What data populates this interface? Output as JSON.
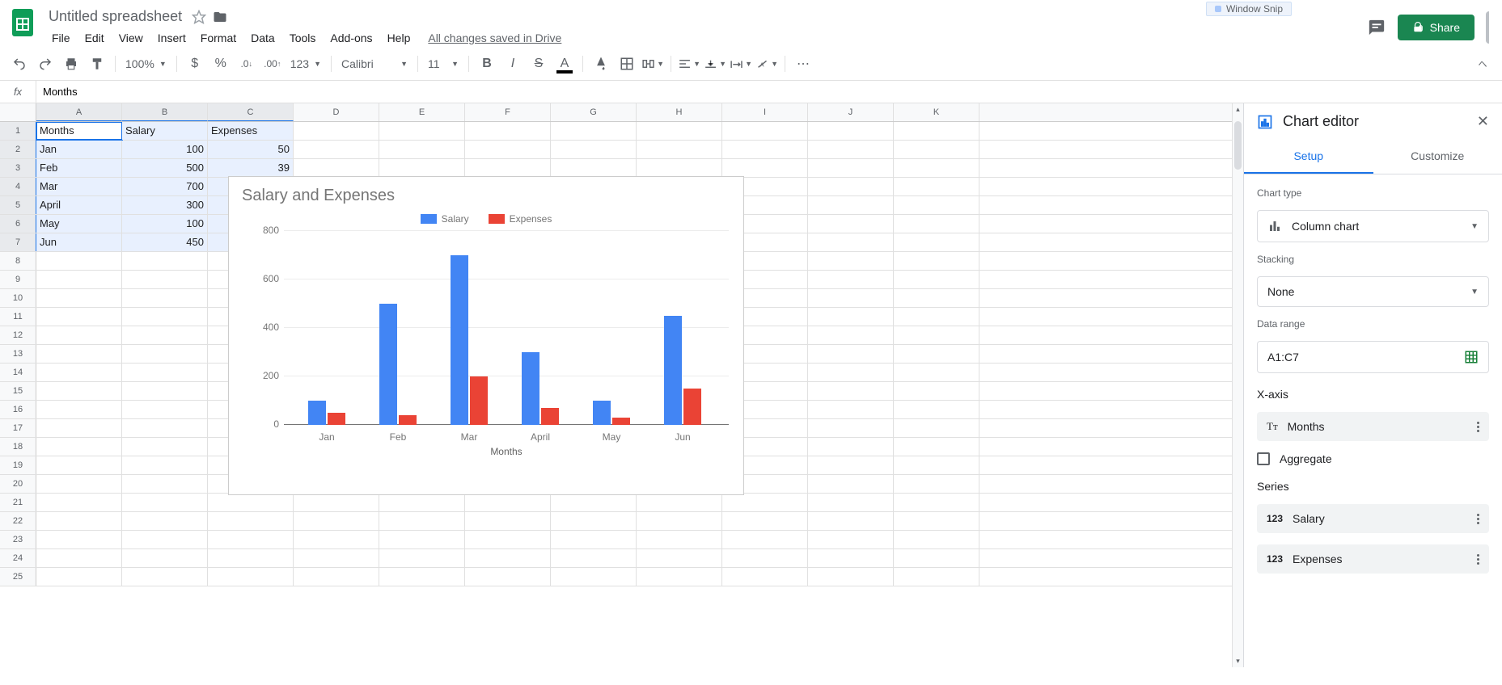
{
  "doc": {
    "title": "Untitled spreadsheet",
    "saved": "All changes saved in Drive"
  },
  "menus": [
    "File",
    "Edit",
    "View",
    "Insert",
    "Format",
    "Data",
    "Tools",
    "Add-ons",
    "Help"
  ],
  "share": "Share",
  "snip": "Window Snip",
  "toolbar": {
    "zoom": "100%",
    "fmt123": "123",
    "font": "Calibri",
    "size": "11"
  },
  "formula": {
    "value": "Months"
  },
  "columns": [
    "A",
    "B",
    "C",
    "D",
    "E",
    "F",
    "G",
    "H",
    "I",
    "J",
    "K"
  ],
  "sheet": {
    "headers": [
      "Months",
      "Salary",
      "Expenses"
    ],
    "rows": [
      [
        "Jan",
        "100",
        "50"
      ],
      [
        "Feb",
        "500",
        "39"
      ],
      [
        "Mar",
        "700",
        ""
      ],
      [
        "April",
        "300",
        ""
      ],
      [
        "May",
        "100",
        ""
      ],
      [
        "Jun",
        "450",
        ""
      ]
    ]
  },
  "chart_data": {
    "type": "bar",
    "title": "Salary and Expenses",
    "xlabel": "Months",
    "ylabel": "",
    "ylim": [
      0,
      800
    ],
    "yticks": [
      0,
      200,
      400,
      600,
      800
    ],
    "categories": [
      "Jan",
      "Feb",
      "Mar",
      "April",
      "May",
      "Jun"
    ],
    "series": [
      {
        "name": "Salary",
        "color": "#4285f4",
        "values": [
          100,
          500,
          700,
          300,
          100,
          450
        ]
      },
      {
        "name": "Expenses",
        "color": "#ea4335",
        "values": [
          50,
          39,
          200,
          70,
          30,
          150
        ]
      }
    ]
  },
  "editor": {
    "title": "Chart editor",
    "tabs": {
      "setup": "Setup",
      "customize": "Customize"
    },
    "chart_type_label": "Chart type",
    "chart_type": "Column chart",
    "stacking_label": "Stacking",
    "stacking": "None",
    "range_label": "Data range",
    "range": "A1:C7",
    "xaxis_label": "X-axis",
    "xaxis_field": "Months",
    "aggregate": "Aggregate",
    "series_label": "Series",
    "series1": "Salary",
    "series2": "Expenses"
  }
}
